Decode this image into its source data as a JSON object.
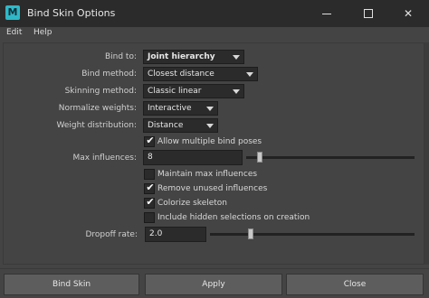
{
  "window": {
    "title": "Bind Skin Options",
    "app_icon_letter": "M"
  },
  "menu": [
    "Edit",
    "Help"
  ],
  "fields": {
    "bind_to": {
      "label": "Bind to:",
      "value": "Joint hierarchy"
    },
    "bind_method": {
      "label": "Bind method:",
      "value": "Closest distance"
    },
    "skinning_method": {
      "label": "Skinning method:",
      "value": "Classic linear"
    },
    "normalize_weights": {
      "label": "Normalize weights:",
      "value": "Interactive"
    },
    "weight_distribution": {
      "label": "Weight distribution:",
      "value": "Distance"
    }
  },
  "checkboxes": {
    "allow_multiple": {
      "label": "Allow multiple bind poses",
      "checked": true
    },
    "maintain_max": {
      "label": "Maintain max influences",
      "checked": false
    },
    "remove_unused": {
      "label": "Remove unused influences",
      "checked": true
    },
    "colorize": {
      "label": "Colorize skeleton",
      "checked": true
    },
    "include_hidden": {
      "label": "Include hidden selections on creation",
      "checked": false
    }
  },
  "max_influences": {
    "label": "Max influences:",
    "value": "8"
  },
  "dropoff_rate": {
    "label": "Dropoff rate:",
    "value": "2.0"
  },
  "check_mark": "✔",
  "buttons": {
    "bind_skin": "Bind Skin",
    "apply": "Apply",
    "close": "Close"
  }
}
